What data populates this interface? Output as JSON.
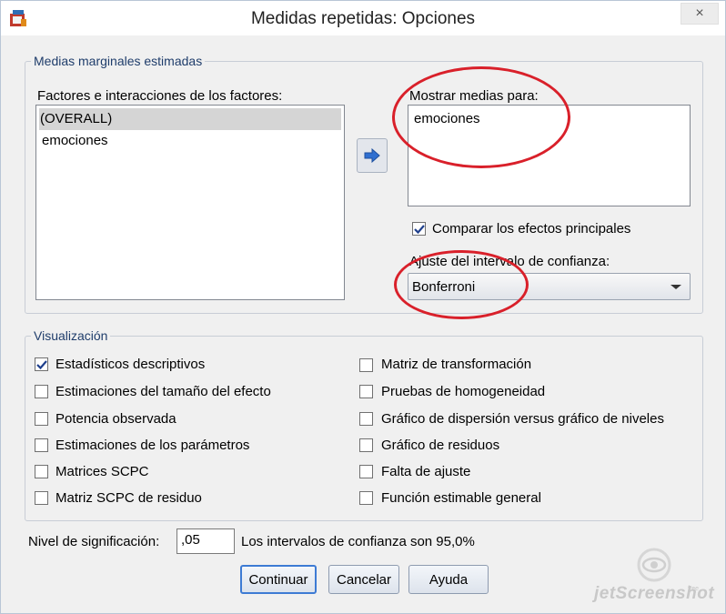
{
  "window": {
    "title": "Medidas repetidas: Opciones",
    "close_glyph": "×"
  },
  "marginal_means": {
    "legend": "Medias marginales estimadas",
    "factors_label": "Factores e interacciones de los factores:",
    "factors": [
      "(OVERALL)",
      "emociones"
    ],
    "display_means_label": "Mostrar medias para:",
    "display_means": [
      "emociones"
    ],
    "compare_main_effects": {
      "label": "Comparar los efectos principales",
      "checked": true
    },
    "ci_adjust_label": "Ajuste del intervalo de confianza:",
    "ci_adjust_value": "Bonferroni"
  },
  "display": {
    "legend": "Visualización",
    "left_options": [
      {
        "label": "Estadísticos descriptivos",
        "checked": true
      },
      {
        "label": "Estimaciones del tamaño del efecto",
        "checked": false
      },
      {
        "label": "Potencia observada",
        "checked": false
      },
      {
        "label": "Estimaciones de los parámetros",
        "checked": false
      },
      {
        "label": "Matrices SCPC",
        "checked": false
      },
      {
        "label": "Matriz SCPC de residuo",
        "checked": false
      }
    ],
    "right_options": [
      {
        "label": "Matriz de transformación",
        "checked": false
      },
      {
        "label": "Pruebas de homogeneidad",
        "checked": false
      },
      {
        "label": "Gráfico de dispersión versus gráfico de niveles",
        "checked": false
      },
      {
        "label": "Gráfico de residuos",
        "checked": false
      },
      {
        "label": "Falta de ajuste",
        "checked": false
      },
      {
        "label": "Función estimable general",
        "checked": false
      }
    ]
  },
  "significance": {
    "label": "Nivel de significación:",
    "value": ",05",
    "ci_text": "Los intervalos de confianza son 95,0%"
  },
  "buttons": {
    "continue": "Continuar",
    "cancel": "Cancelar",
    "help": "Ayuda"
  },
  "watermark": {
    "text": "jetScreenshot",
    "sub": "free"
  },
  "colors": {
    "annotation_circle": "#d9202a",
    "accent": "#3d7bd4"
  }
}
